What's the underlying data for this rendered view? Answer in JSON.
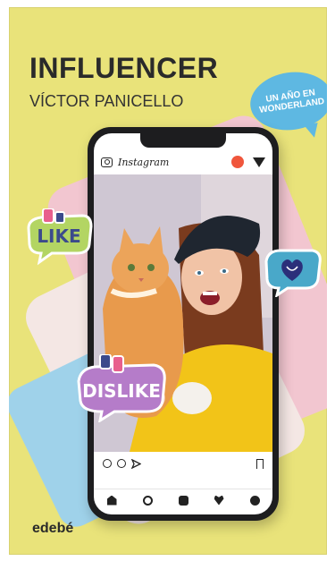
{
  "cover": {
    "title": "INFLUENCER",
    "author": "VÍCTOR PANICELLO",
    "bubble_text": "UN AÑO EN WONDERLAND",
    "publisher": "edebé",
    "background_color": "#e9e37a"
  },
  "phone": {
    "app_name": "Instagram",
    "header_icons": [
      "camera-icon",
      "story-icon",
      "send-icon"
    ],
    "action_icons": [
      "heart-icon",
      "comment-icon",
      "share-icon",
      "bookmark-icon"
    ],
    "nav_icons": [
      "home-icon",
      "search-icon",
      "add-icon",
      "heart-icon",
      "profile-icon"
    ]
  },
  "stickers": {
    "like": "LIKE",
    "dislike": "DISLIKE"
  }
}
